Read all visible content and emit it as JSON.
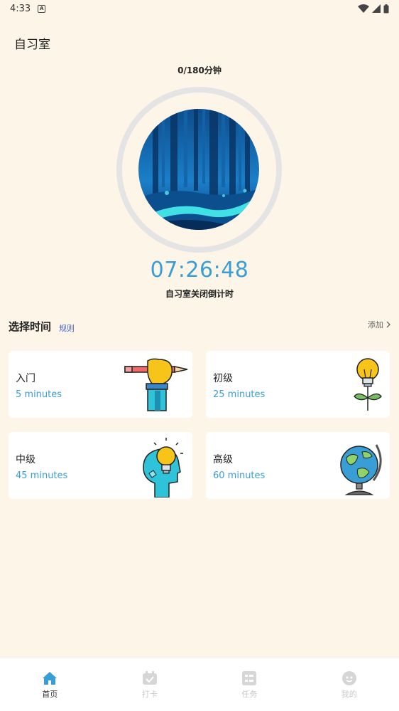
{
  "status_bar": {
    "time": "4:33"
  },
  "header": {
    "title": "自习室"
  },
  "progress": {
    "text": "0/180分钟"
  },
  "timer": {
    "countdown": "07:26:48",
    "label": "自习室关闭倒计时"
  },
  "section": {
    "title": "选择时间",
    "rules_link": "规则",
    "add_link": "添加"
  },
  "levels": [
    {
      "name": "入门",
      "duration": "5 minutes",
      "icon": "pencil-hand-icon"
    },
    {
      "name": "初级",
      "duration": "25 minutes",
      "icon": "lightbulb-plant-icon"
    },
    {
      "name": "中级",
      "duration": "45 minutes",
      "icon": "head-lightbulb-icon"
    },
    {
      "name": "高级",
      "duration": "60 minutes",
      "icon": "globe-icon"
    }
  ],
  "tabs": [
    {
      "label": "首页",
      "icon": "home-icon",
      "active": true
    },
    {
      "label": "打卡",
      "icon": "checkin-icon",
      "active": false
    },
    {
      "label": "任务",
      "icon": "task-icon",
      "active": false
    },
    {
      "label": "我的",
      "icon": "profile-icon",
      "active": false
    }
  ],
  "colors": {
    "accent": "#3a9ed6",
    "background": "#fdf5e8",
    "link": "#4a67d6"
  }
}
